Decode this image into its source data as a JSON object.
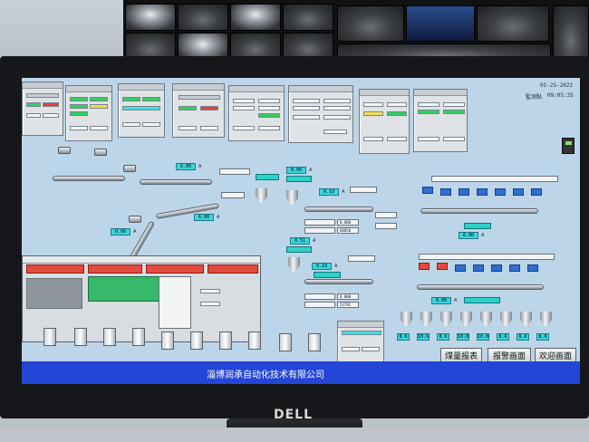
{
  "hmi": {
    "date": "05-25-2022",
    "time": "09:05:35",
    "status_label": "監測點",
    "company": "淄博润承自动化技术有限公司",
    "nav": {
      "report": "煤量报表",
      "alarm": "报警画面",
      "welcome": "欢迎画面"
    },
    "readings": {
      "r1": "6.00",
      "r2": "0.00",
      "r3": "6.00",
      "r4": "0.00",
      "r5": "0.00",
      "r6": "0.51",
      "r7": "0.19",
      "r8": "0.17",
      "r9": "0.19",
      "r10": "6.00",
      "r11": "0.00",
      "unit": "A"
    },
    "counters": {
      "a1": "0.000",
      "a2": "68050",
      "b1": "0.000",
      "b2": "53792"
    },
    "side_values": [
      "8.6",
      "10.6",
      "8.6",
      "10.0",
      "10.0",
      "8.6",
      "8.6",
      "8.6",
      "10.0"
    ]
  }
}
